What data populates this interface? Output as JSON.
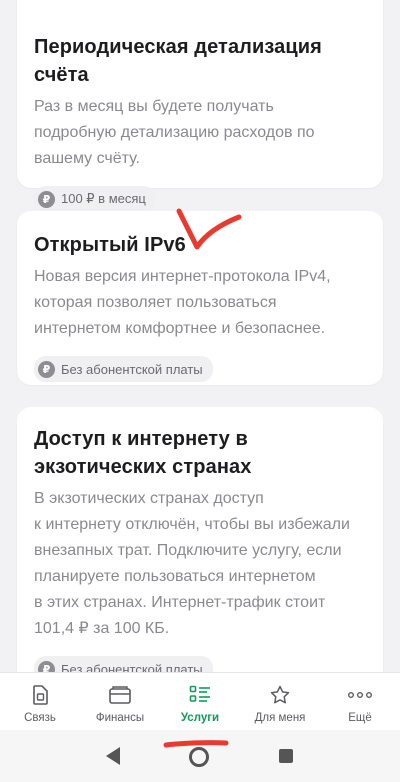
{
  "cards": [
    {
      "title": "Периодическая детализация счёта",
      "desc_lines": [
        "Раз в месяц вы будете получать",
        "подробную детализацию расходов по",
        "вашему счёту."
      ],
      "badge": "100 ₽ в месяц"
    },
    {
      "title": "Открытый IPv6",
      "desc_lines": [
        "Новая версия интернет-протокола IPv4,",
        "которая позволяет пользоваться",
        "интернетом комфортнее и безопаснее."
      ],
      "badge": "Без абонентской платы"
    },
    {
      "title_lines": [
        "Доступ к интернету в",
        "экзотических странах"
      ],
      "desc_lines": [
        "В экзотических странах доступ",
        "к интернету отключён, чтобы вы избежали",
        "внезапных трат. Подключите услугу, если",
        "планируете пользоваться интернетом",
        "в этих странах. Интернет-трафик стоит",
        "101,4 ₽ за 100 КБ."
      ],
      "badge": "Без абонентской платы"
    }
  ],
  "currency_icon": "₽",
  "nav": {
    "items": [
      {
        "label": "Связь",
        "icon": "sim-icon"
      },
      {
        "label": "Финансы",
        "icon": "wallet-icon"
      },
      {
        "label": "Услуги",
        "icon": "services-list-icon"
      },
      {
        "label": "Для меня",
        "icon": "star-icon"
      },
      {
        "label": "Ещё",
        "icon": "more-icon"
      }
    ],
    "active_index": 2
  },
  "colors": {
    "accent": "#0f9d58",
    "annotation": "#e83a2f"
  }
}
